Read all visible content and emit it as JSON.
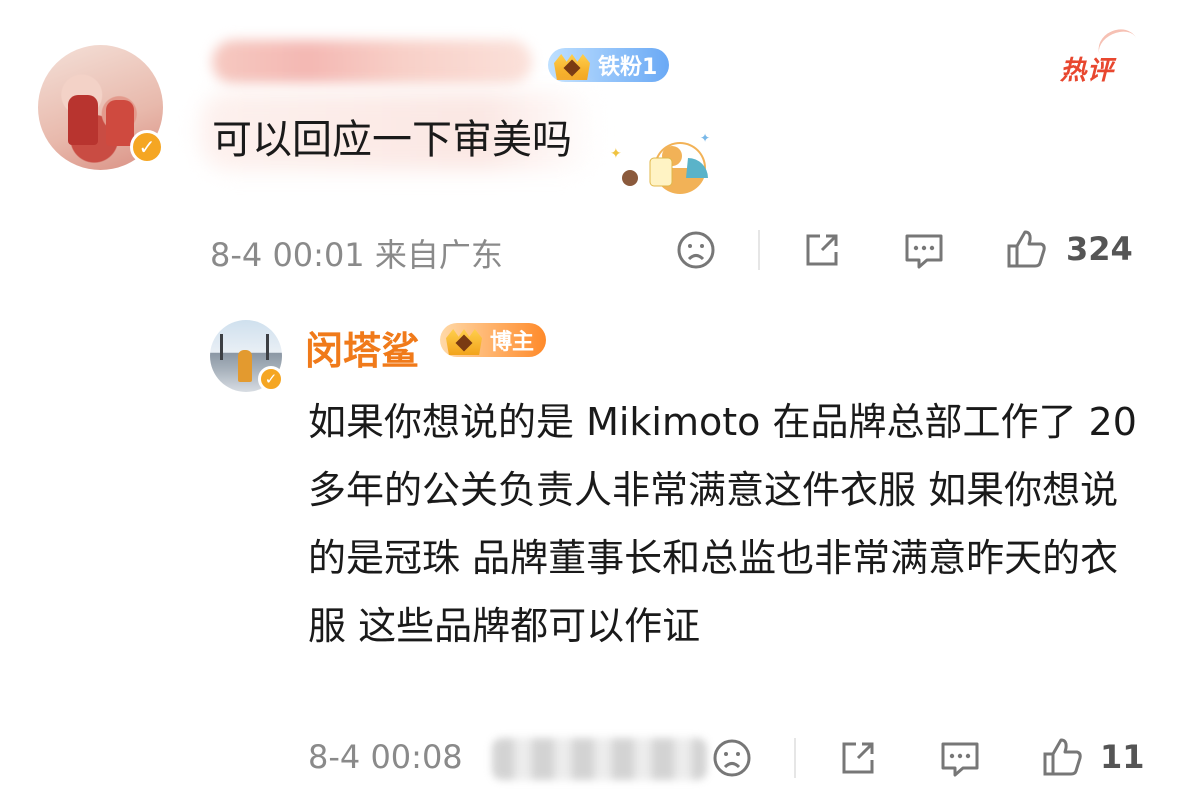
{
  "top_comment": {
    "badge_label": "铁粉1",
    "hot_label": "热评",
    "text": "可以回应一下审美吗",
    "time": "8-4 00:01",
    "location": "来自广东",
    "like_count": "324"
  },
  "reply": {
    "username": "闵塔鲨",
    "badge_label": "博主",
    "text": "如果你想说的是 Mikimoto 在品牌总部工作了 20 多年的公关负责人非常满意这件衣服 如果你想说的是冠珠 品牌董事长和总监也非常满意昨天的衣服 这些品牌都可以作证",
    "time": "8-4 00:08",
    "like_count": "11"
  },
  "icons": {
    "dislike": "sad-face-icon",
    "share": "share-icon",
    "comment": "comment-icon",
    "like": "thumbs-up-icon",
    "verified": "verified-v-icon"
  },
  "colors": {
    "username_accent": "#f07a1a",
    "hot_label": "#e8472f",
    "verified": "#f5a623",
    "meta_text": "#8a8a8a"
  }
}
